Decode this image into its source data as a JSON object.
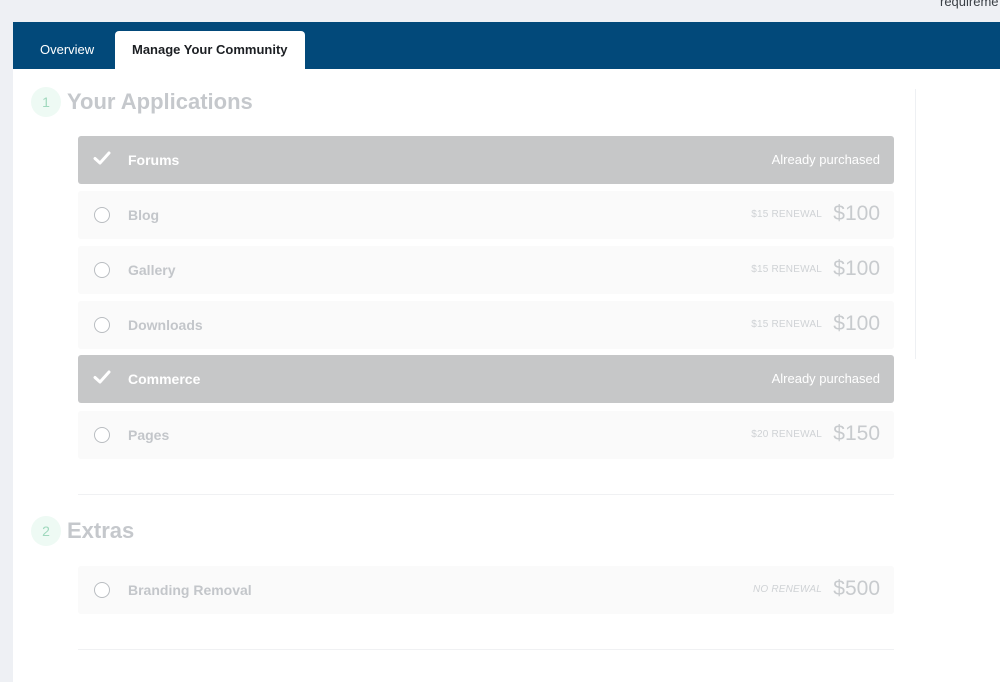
{
  "top_text": "requireme",
  "tabs": [
    {
      "label": "Overview",
      "active": false
    },
    {
      "label": "Manage Your Community",
      "active": true
    }
  ],
  "sections": [
    {
      "number": "1",
      "title": "Your Applications",
      "items": [
        {
          "name": "Forums",
          "state": "purchased",
          "status": "Already purchased"
        },
        {
          "name": "Blog",
          "state": "available",
          "renewal": "$15 RENEWAL",
          "price": "$100"
        },
        {
          "name": "Gallery",
          "state": "available",
          "renewal": "$15 RENEWAL",
          "price": "$100"
        },
        {
          "name": "Downloads",
          "state": "available",
          "renewal": "$15 RENEWAL",
          "price": "$100"
        },
        {
          "name": "Commerce",
          "state": "purchased",
          "status": "Already purchased"
        },
        {
          "name": "Pages",
          "state": "available",
          "renewal": "$20 RENEWAL",
          "price": "$150"
        }
      ]
    },
    {
      "number": "2",
      "title": "Extras",
      "items": [
        {
          "name": "Branding Removal",
          "state": "available",
          "renewal": "NO RENEWAL",
          "price": "$500"
        }
      ]
    }
  ],
  "colors": {
    "header_bg": "#02497a",
    "purchased_bg": "#c6c7c8",
    "available_bg": "#fafafa",
    "step_accent": "#9fd8bd"
  }
}
